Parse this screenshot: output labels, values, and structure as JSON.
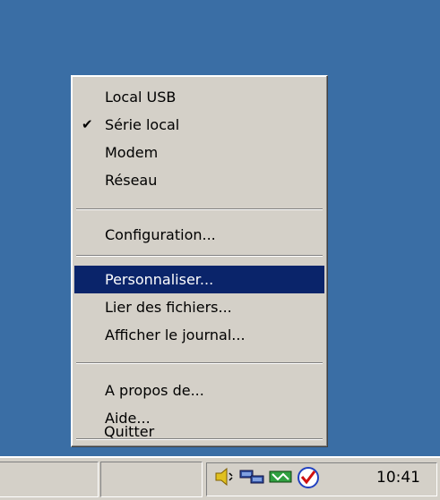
{
  "menu": {
    "items": [
      {
        "label": "Local USB",
        "checked": false
      },
      {
        "label": "Série local",
        "checked": true
      },
      {
        "label": "Modem",
        "checked": false
      },
      {
        "label": "Réseau",
        "checked": false
      },
      {
        "label": "Configuration..."
      },
      {
        "label": "Personnaliser...",
        "highlighted": true
      },
      {
        "label": "Lier des fichiers..."
      },
      {
        "label": "Afficher le journal..."
      },
      {
        "label": "A propos de..."
      },
      {
        "label": "Aide..."
      },
      {
        "label": "Quitter"
      }
    ],
    "check_glyph": "✔"
  },
  "taskbar": {
    "clock": "10:41"
  },
  "colors": {
    "desktop": "#3a6ea5",
    "menu_bg": "#d4d0c8",
    "highlight": "#0a246a"
  }
}
